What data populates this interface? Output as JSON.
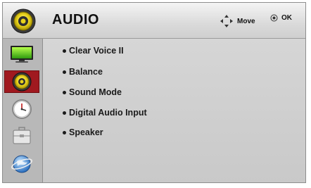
{
  "header": {
    "title": "AUDIO",
    "move_label": "Move",
    "ok_label": "OK",
    "icon": "speaker-icon"
  },
  "sidebar": {
    "items": [
      {
        "name": "picture",
        "icon": "tv-icon",
        "selected": false
      },
      {
        "name": "audio",
        "icon": "speaker-icon",
        "selected": true
      },
      {
        "name": "time",
        "icon": "clock-icon",
        "selected": false
      },
      {
        "name": "option",
        "icon": "toolbox-icon",
        "selected": false
      },
      {
        "name": "network",
        "icon": "globe-icon",
        "selected": false
      }
    ]
  },
  "menu": {
    "items": [
      {
        "label": "Clear Voice II"
      },
      {
        "label": "Balance"
      },
      {
        "label": "Sound Mode"
      },
      {
        "label": "Digital Audio Input"
      },
      {
        "label": "Speaker"
      }
    ]
  },
  "colors": {
    "selected": "#a0191f",
    "speaker_yellow": "#e8d21c"
  }
}
